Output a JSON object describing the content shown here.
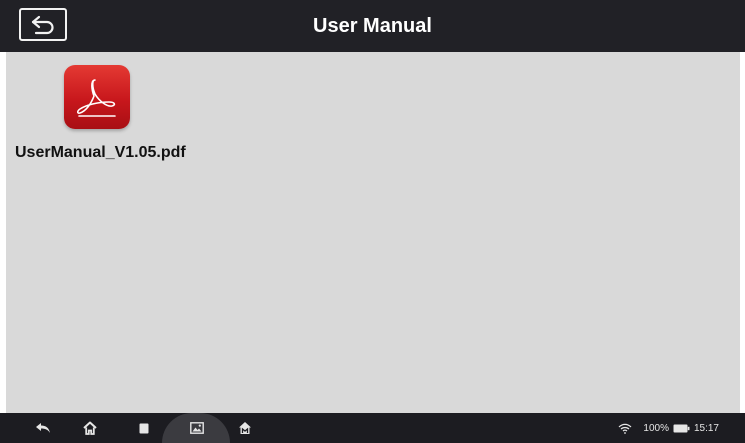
{
  "header": {
    "title": "User Manual"
  },
  "files": [
    {
      "name": "UserManual_V1.05.pdf",
      "icon": "pdf-icon"
    }
  ],
  "status": {
    "battery": "100%",
    "time": "15:17"
  },
  "navbar": {
    "buttons": [
      "back-icon",
      "home-icon",
      "recent-apps-icon",
      "screenshot-icon",
      "vci-home-icon"
    ]
  },
  "colors": {
    "header_bg": "#212126",
    "content_bg": "#d9d9d9",
    "navbar_bg": "#1c1c21",
    "pdf_red": "#d42027"
  }
}
